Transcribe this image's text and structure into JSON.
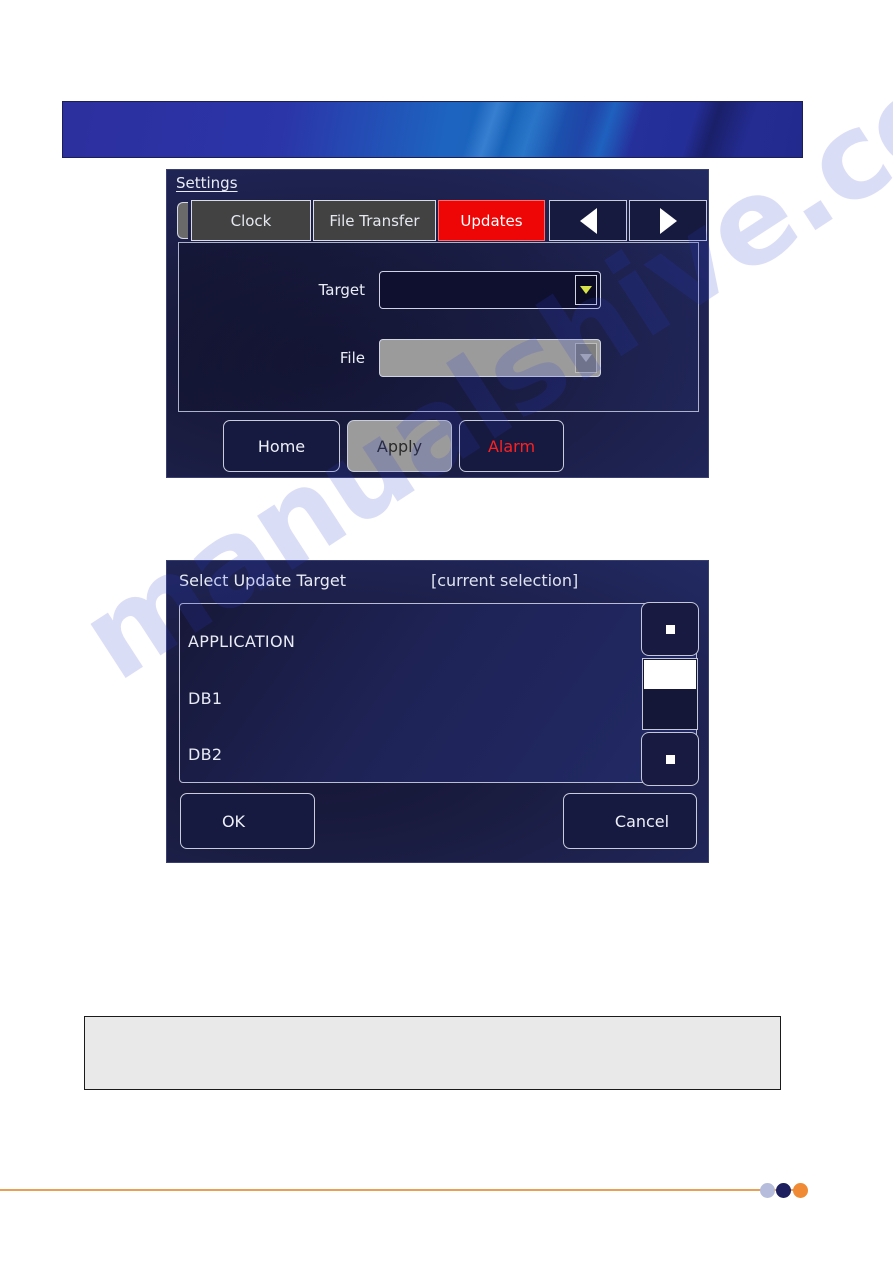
{
  "page": {
    "watermark_text": "manualshive.com",
    "background": "#ffffff"
  },
  "banner": {
    "name": "decorative-header-banner",
    "colors": [
      "#2c2f9e",
      "#1d64c0",
      "#232a8e"
    ]
  },
  "settings_screen": {
    "title": "Settings",
    "tabs": [
      {
        "label": "Clock",
        "active": false
      },
      {
        "label": "File Transfer",
        "active": false
      },
      {
        "label": "Updates",
        "active": true
      }
    ],
    "nav": {
      "prev_icon": "triangle-left-icon",
      "next_icon": "triangle-right-icon"
    },
    "fields": [
      {
        "label": "Target",
        "value": "",
        "disabled": false,
        "arrow_color": "#d8e24a"
      },
      {
        "label": "File",
        "value": "",
        "disabled": true,
        "arrow_color": "#b7b7b7"
      }
    ],
    "buttons": [
      {
        "label": "Home",
        "style": "normal"
      },
      {
        "label": "Apply",
        "style": "disabled"
      },
      {
        "label": "Alarm",
        "style": "alarm"
      }
    ],
    "colors": {
      "active_tab": "#ee0505",
      "inactive_tab": "#424242",
      "alarm_text": "#ff2020",
      "screen_bg": "#1a1c40"
    }
  },
  "select_dialog": {
    "title": "Select Update Target",
    "subtitle": "[current selection]",
    "items": [
      "APPLICATION",
      "DB1",
      "DB2"
    ],
    "scrollbar": {
      "up_icon": "scroll-up-icon",
      "down_icon": "scroll-down-icon",
      "thumb_position": "top"
    },
    "buttons": [
      {
        "label": "OK"
      },
      {
        "label": "Cancel"
      }
    ]
  },
  "note_box": {
    "text": "",
    "bg": "#e9e9e9"
  },
  "footer": {
    "line_color": "#e8a056",
    "dots": [
      "#b6bcdc",
      "#1d1f5e",
      "#f08a34"
    ]
  }
}
